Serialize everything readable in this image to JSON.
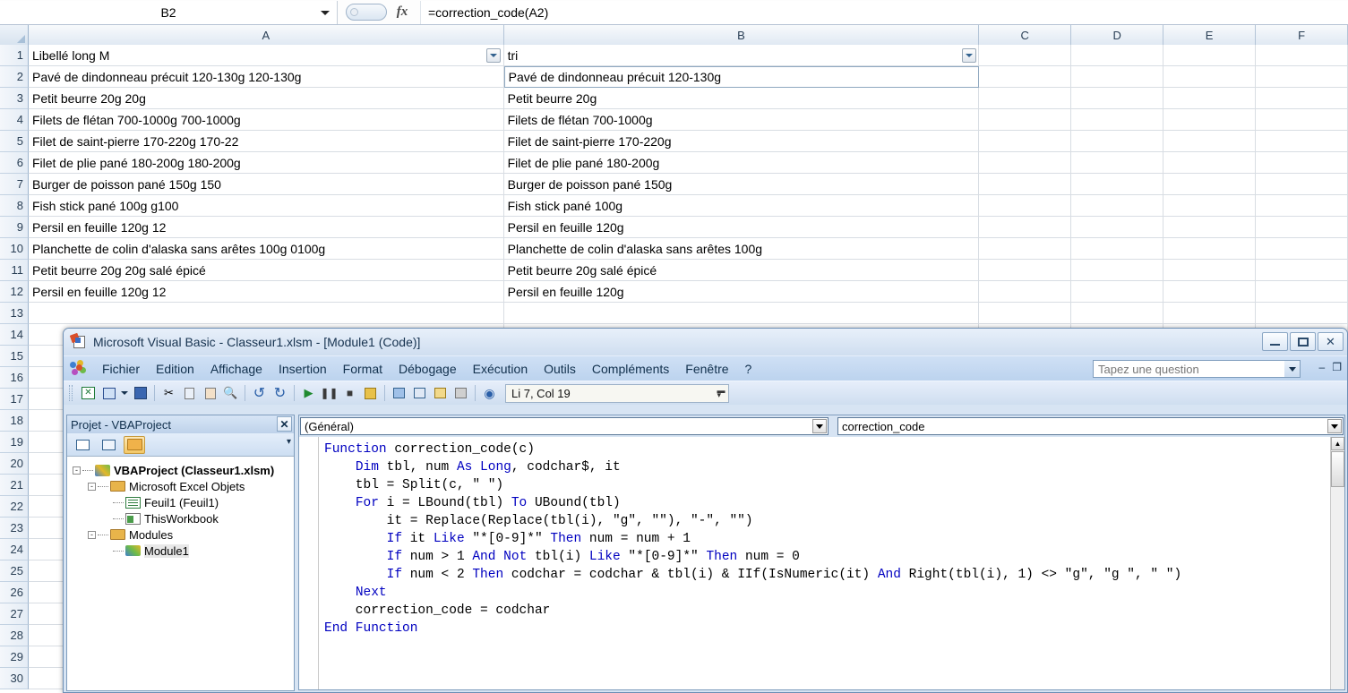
{
  "excel": {
    "namebox": {
      "value": "B2",
      "icon": "chevron-down-icon"
    },
    "formula_bar": {
      "fx_label": "fx",
      "value": "=correction_code(A2)"
    },
    "columns": [
      "A",
      "B",
      "C",
      "D",
      "E",
      "F"
    ],
    "row_numbers": [
      "1",
      "2",
      "3",
      "4",
      "5",
      "6",
      "7",
      "8",
      "9",
      "10",
      "11",
      "12",
      "13",
      "14",
      "15",
      "16",
      "17",
      "18",
      "19",
      "20",
      "21",
      "22",
      "23",
      "24",
      "25",
      "26",
      "27",
      "28",
      "29",
      "30"
    ],
    "rows": [
      {
        "a": "Libellé long M",
        "b": "tri"
      },
      {
        "a": "Pavé de dindonneau précuit 120-130g 120-130g",
        "b": "Pavé de dindonneau précuit 120-130g"
      },
      {
        "a": "Petit beurre 20g 20g",
        "b": "Petit beurre 20g"
      },
      {
        "a": "Filets de flétan 700-1000g 700-1000g",
        "b": "Filets de flétan 700-1000g"
      },
      {
        "a": "Filet de saint-pierre 170-220g 170-22",
        "b": "Filet de saint-pierre 170-220g"
      },
      {
        "a": "Filet de plie pané 180-200g 180-200g",
        "b": "Filet de plie pané 180-200g"
      },
      {
        "a": "Burger de poisson pané 150g 150",
        "b": "Burger de poisson pané 150g"
      },
      {
        "a": "Fish stick pané 100g g100",
        "b": "Fish stick pané 100g"
      },
      {
        "a": "Persil en feuille 120g 12",
        "b": "Persil en feuille 120g"
      },
      {
        "a": "Planchette de colin d'alaska sans arêtes 100g 0100g",
        "b": "Planchette de colin d'alaska sans arêtes 100g"
      },
      {
        "a": "Petit beurre 20g 20g salé épicé",
        "b": "Petit beurre 20g salé épicé"
      },
      {
        "a": "Persil en feuille 120g 12",
        "b": "Persil en feuille 120g"
      },
      {
        "a": "",
        "b": ""
      },
      {
        "a": "",
        "b": ""
      },
      {
        "a": "",
        "b": ""
      },
      {
        "a": "",
        "b": ""
      },
      {
        "a": "",
        "b": ""
      },
      {
        "a": "",
        "b": ""
      },
      {
        "a": "",
        "b": ""
      },
      {
        "a": "",
        "b": ""
      },
      {
        "a": "",
        "b": ""
      },
      {
        "a": "",
        "b": ""
      },
      {
        "a": "",
        "b": ""
      },
      {
        "a": "",
        "b": ""
      },
      {
        "a": "",
        "b": ""
      },
      {
        "a": "",
        "b": ""
      },
      {
        "a": "",
        "b": ""
      },
      {
        "a": "",
        "b": ""
      },
      {
        "a": "",
        "b": ""
      },
      {
        "a": "",
        "b": ""
      }
    ]
  },
  "vba": {
    "title": "Microsoft Visual Basic - Classeur1.xlsm - [Module1 (Code)]",
    "window_buttons": {
      "minimize": "minimize-icon",
      "restore": "restore-icon",
      "close": "✕"
    },
    "menu": [
      {
        "label": "Fichier",
        "accel": "F"
      },
      {
        "label": "Edition",
        "accel": "E"
      },
      {
        "label": "Affichage",
        "accel": "A"
      },
      {
        "label": "Insertion",
        "accel": "I"
      },
      {
        "label": "Format",
        "accel": "t"
      },
      {
        "label": "Débogage",
        "accel": "D"
      },
      {
        "label": "Exécution",
        "accel": "x"
      },
      {
        "label": "Outils",
        "accel": "O"
      },
      {
        "label": "Compléments",
        "accel": "C"
      },
      {
        "label": "Fenêtre",
        "accel": "n"
      },
      {
        "label": "?",
        "accel": ""
      }
    ],
    "ask_box": {
      "placeholder": "Tapez une question",
      "value": ""
    },
    "mdi_buttons": {
      "minimize": "–",
      "restore": "❐"
    },
    "toolbar": {
      "icons": [
        "excel-view-icon",
        "insert-userform-icon",
        "save-icon",
        "cut-icon",
        "copy-icon",
        "paste-icon",
        "find-icon",
        "undo-icon",
        "redo-icon",
        "run-icon",
        "break-icon",
        "reset-icon",
        "design-mode-icon",
        "project-explorer-icon",
        "properties-window-icon",
        "object-browser-icon",
        "toolbox-icon",
        "help-icon"
      ],
      "position_indicator": "Li 7, Col 19"
    },
    "project_explorer": {
      "title": "Projet - VBAProject",
      "close_label": "✕",
      "toolbar_buttons": [
        "view-code-icon",
        "view-object-icon",
        "toggle-folders-icon"
      ],
      "tree": [
        {
          "label": "VBAProject (Classeur1.xlsm)",
          "depth": 0,
          "icon": "vbaproject-icon",
          "bold": true,
          "expander": "-"
        },
        {
          "label": "Microsoft Excel Objets",
          "depth": 1,
          "icon": "folder-icon",
          "bold": false,
          "expander": "-"
        },
        {
          "label": "Feuil1 (Feuil1)",
          "depth": 2,
          "icon": "worksheet-icon",
          "bold": false,
          "expander": ""
        },
        {
          "label": "ThisWorkbook",
          "depth": 2,
          "icon": "workbook-icon",
          "bold": false,
          "expander": ""
        },
        {
          "label": "Modules",
          "depth": 1,
          "icon": "folder-icon",
          "bold": false,
          "expander": "-"
        },
        {
          "label": "Module1",
          "depth": 2,
          "icon": "module-icon",
          "bold": false,
          "expander": "",
          "selected": true
        }
      ]
    },
    "code_window": {
      "object_dropdown": "(Général)",
      "procedure_dropdown": "correction_code",
      "code_lines": [
        [
          {
            "t": "Function",
            "k": true
          },
          {
            "t": " correction_code(c)",
            "k": false
          }
        ],
        [
          {
            "t": "    ",
            "k": false
          },
          {
            "t": "Dim",
            "k": true
          },
          {
            "t": " tbl, num ",
            "k": false
          },
          {
            "t": "As",
            "k": true
          },
          {
            "t": " ",
            "k": false
          },
          {
            "t": "Long",
            "k": true
          },
          {
            "t": ", codchar$, it",
            "k": false
          }
        ],
        [
          {
            "t": "    tbl = Split(c, \" \")",
            "k": false
          }
        ],
        [
          {
            "t": "    ",
            "k": false
          },
          {
            "t": "For",
            "k": true
          },
          {
            "t": " i = LBound(tbl) ",
            "k": false
          },
          {
            "t": "To",
            "k": true
          },
          {
            "t": " UBound(tbl)",
            "k": false
          }
        ],
        [
          {
            "t": "        it = Replace(Replace(tbl(i), \"g\", \"\"), \"-\", \"\")",
            "k": false
          }
        ],
        [
          {
            "t": "        ",
            "k": false
          },
          {
            "t": "If",
            "k": true
          },
          {
            "t": " it ",
            "k": false
          },
          {
            "t": "Like",
            "k": true
          },
          {
            "t": " \"*[0-9]*\" ",
            "k": false
          },
          {
            "t": "Then",
            "k": true
          },
          {
            "t": " num = num + 1",
            "k": false
          }
        ],
        [
          {
            "t": "        ",
            "k": false
          },
          {
            "t": "If",
            "k": true
          },
          {
            "t": " num > 1 ",
            "k": false
          },
          {
            "t": "And",
            "k": true
          },
          {
            "t": " ",
            "k": false
          },
          {
            "t": "Not",
            "k": true
          },
          {
            "t": " tbl(i) ",
            "k": false
          },
          {
            "t": "Like",
            "k": true
          },
          {
            "t": " \"*[0-9]*\" ",
            "k": false
          },
          {
            "t": "Then",
            "k": true
          },
          {
            "t": " num = 0",
            "k": false
          }
        ],
        [
          {
            "t": "        ",
            "k": false
          },
          {
            "t": "If",
            "k": true
          },
          {
            "t": " num < 2 ",
            "k": false
          },
          {
            "t": "Then",
            "k": true
          },
          {
            "t": " codchar = codchar & tbl(i) & IIf(IsNumeric(it) ",
            "k": false
          },
          {
            "t": "And",
            "k": true
          },
          {
            "t": " Right(tbl(i), 1) <> \"g\", \"g \", \" \")",
            "k": false
          }
        ],
        [
          {
            "t": "    ",
            "k": false
          },
          {
            "t": "Next",
            "k": true
          }
        ],
        [
          {
            "t": "    correction_code = codchar",
            "k": false
          }
        ],
        [
          {
            "t": "End Function",
            "k": true
          }
        ]
      ]
    }
  }
}
